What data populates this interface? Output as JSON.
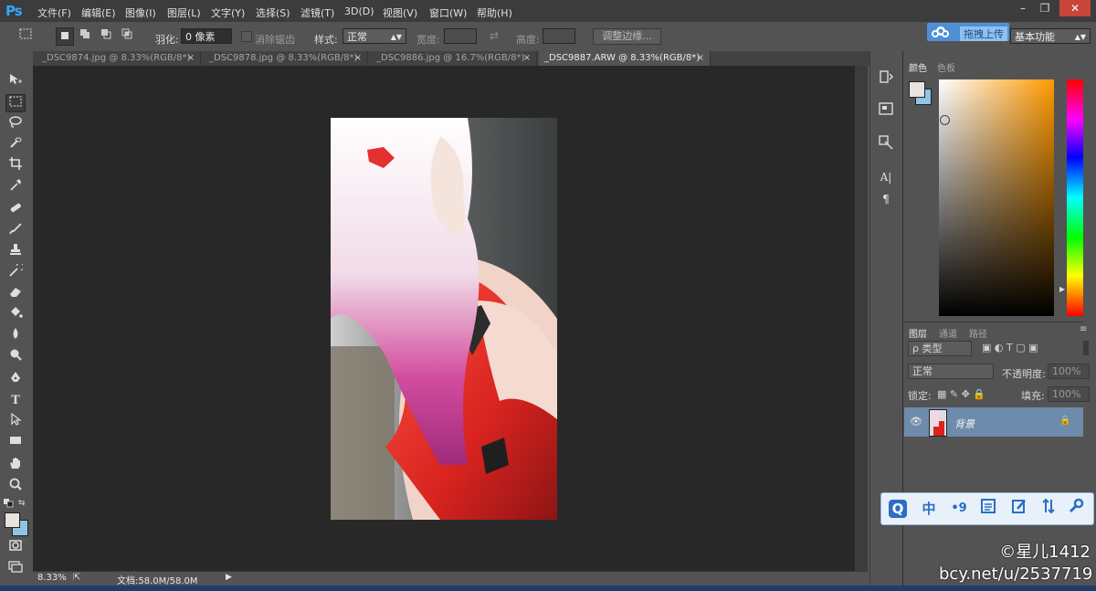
{
  "app": {
    "logo": "Ps"
  },
  "menu": [
    "文件(F)",
    "编辑(E)",
    "图像(I)",
    "图层(L)",
    "文字(Y)",
    "选择(S)",
    "滤镜(T)",
    "3D(D)",
    "视图(V)",
    "窗口(W)",
    "帮助(H)"
  ],
  "window_controls": [
    "–",
    "❐",
    "✕"
  ],
  "options": {
    "feather_label": "羽化:",
    "feather_value": "0 像素",
    "antialias_label": "消除锯齿",
    "style_label": "样式:",
    "style_value": "正常",
    "width_label": "宽度:",
    "height_label": "高度:",
    "refine_edge": "调整边缘...",
    "upload_label": "拖拽上传",
    "workspace": "基本功能"
  },
  "tabs": [
    {
      "label": "_DSC9874.jpg @ 8.33%(RGB/8*)",
      "close": "×",
      "active": false
    },
    {
      "label": "_DSC9878.jpg @ 8.33%(RGB/8*)",
      "close": "×",
      "active": false
    },
    {
      "label": "_DSC9886.jpg @ 16.7%(RGB/8*)",
      "close": "×",
      "active": false
    },
    {
      "label": "_DSC9887.ARW @ 8.33%(RGB/8*)",
      "close": "×",
      "active": true
    }
  ],
  "status": {
    "zoom": "8.33%",
    "doc": "文档:58.0M/58.0M",
    "arrow": "▶"
  },
  "color_panel": {
    "tabs": [
      "颜色",
      "色板"
    ]
  },
  "layers_panel": {
    "tabs": [
      "图层",
      "通道",
      "路径"
    ],
    "filter": "ρ 类型",
    "blend_mode": "正常",
    "opacity_label": "不透明度:",
    "opacity_value": "100%",
    "lock_label": "锁定:",
    "fill_label": "填充:",
    "fill_value": "100%",
    "layer_name": "背景"
  },
  "ime": [
    "中",
    "•9"
  ],
  "watermark": {
    "line1": "©星儿1412",
    "line2": "bcy.net/u/2537719"
  },
  "colors": {
    "accent": "#31a8ff",
    "selected_layer": "#6f8bab",
    "canvas": "#282828"
  }
}
